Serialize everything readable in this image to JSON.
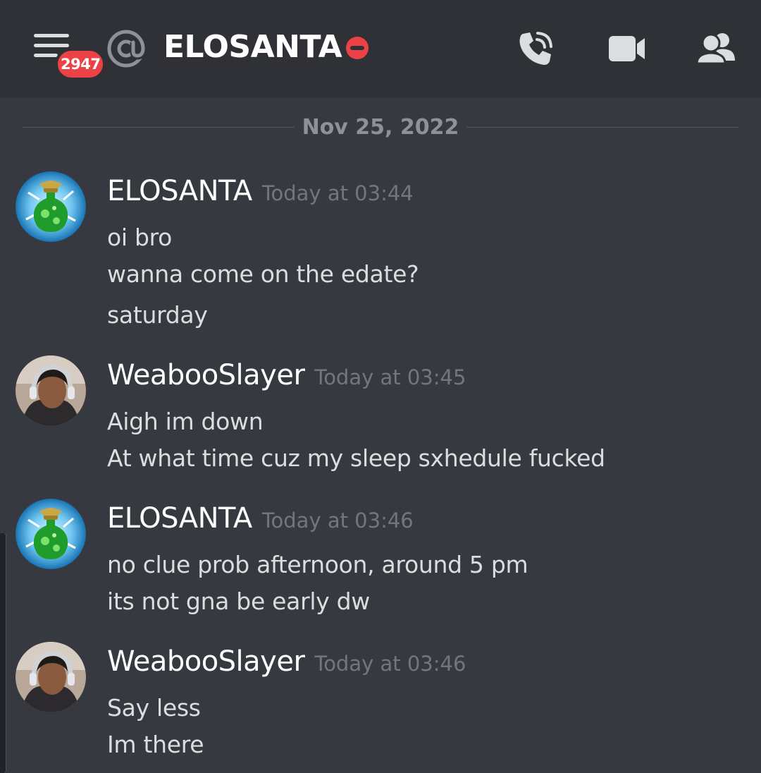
{
  "header": {
    "menu_badge": "2947",
    "channel_title": "ELOSANTA",
    "icons": {
      "menu": "hamburger-menu-icon",
      "at": "at-sign-icon",
      "status": "do-not-disturb-icon",
      "call": "phone-call-icon",
      "video": "video-camera-icon",
      "members": "members-icon"
    }
  },
  "divider": {
    "date": "Nov 25, 2022"
  },
  "messages": [
    {
      "username": "ELOSANTA",
      "timestamp": "Today at 03:44",
      "lines": [
        "oi bro",
        "wanna come on the edate?",
        "saturday"
      ]
    },
    {
      "username": "WeabooSlayer",
      "timestamp": "Today at 03:45",
      "lines": [
        "Aigh im down",
        "At what time cuz my sleep sxhedule fucked"
      ]
    },
    {
      "username": "ELOSANTA",
      "timestamp": "Today at 03:46",
      "lines": [
        "no clue prob afternoon, around 5 pm",
        "its not gna be early dw"
      ]
    },
    {
      "username": "WeabooSlayer",
      "timestamp": "Today at 03:46",
      "lines": [
        "Say less",
        "Im there"
      ]
    }
  ],
  "colors": {
    "background": "#36393f",
    "topbar": "#2f3136",
    "badge": "#ed4245",
    "timestamp": "#72767d",
    "divider_text": "#8e9297"
  }
}
